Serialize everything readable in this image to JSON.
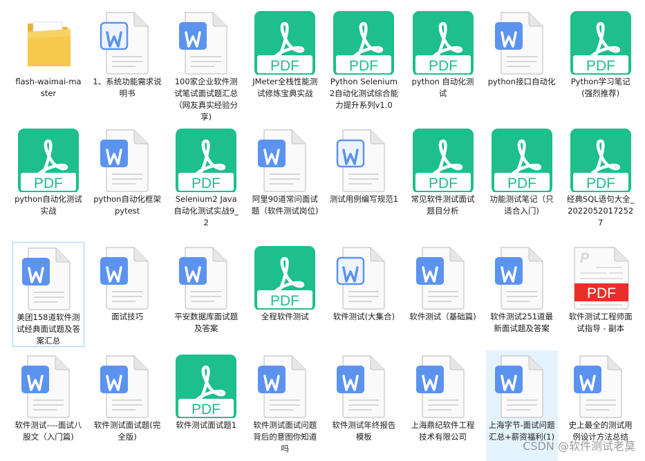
{
  "colors": {
    "pdf_green": "#1dbf8c",
    "word_blue": "#5b93ef",
    "pdf_red": "#e8302a",
    "folder": "#f6c94c",
    "selection_bg": "#e5f3ff",
    "focus_border": "#99d1ff"
  },
  "files": [
    {
      "name": "flash-waimai-master",
      "icon": "folder-icon"
    },
    {
      "name": "1、系统功能需求说明书",
      "icon": "word-outline-icon"
    },
    {
      "name": "100家企业软件测试笔试面试题汇总（网友真实经验分享)",
      "icon": "word-icon"
    },
    {
      "name": "JMeter全栈性能测试修炼宝典实战",
      "icon": "pdf-icon"
    },
    {
      "name": "Python Selenium2自动化测试综合能力提升系列v1.0",
      "icon": "pdf-icon"
    },
    {
      "name": "python 自动化测试",
      "icon": "pdf-icon"
    },
    {
      "name": "python接口自动化",
      "icon": "word-icon"
    },
    {
      "name": "Python学习笔记(强烈推荐)",
      "icon": "pdf-icon"
    },
    {
      "name": "python自动化测试实战",
      "icon": "pdf-icon"
    },
    {
      "name": "python自动化框架pytest",
      "icon": "word-icon"
    },
    {
      "name": "Selenium2 Java自动化测试实战9_2",
      "icon": "pdf-icon"
    },
    {
      "name": "阿里90道常问面试题（软件测试岗位)",
      "icon": "word-icon"
    },
    {
      "name": "测试用例编写规范1",
      "icon": "word-outline-icon"
    },
    {
      "name": "常见软件测试面试题目分析",
      "icon": "pdf-icon"
    },
    {
      "name": "功能测试笔记（只适合入门)",
      "icon": "pdf-icon"
    },
    {
      "name": "经典SQL语句大全_20220520172527",
      "icon": "pdf-icon"
    },
    {
      "name": "美团158道软件测试经典面试题及答案汇总",
      "icon": "word-icon",
      "state": "focus"
    },
    {
      "name": "面试技巧",
      "icon": "word-icon"
    },
    {
      "name": "平安数据库面试题及答案",
      "icon": "word-icon"
    },
    {
      "name": "全程软件测试",
      "icon": "pdf-icon"
    },
    {
      "name": "软件测试(大集合)",
      "icon": "word-outline-icon"
    },
    {
      "name": "软件测试（基础篇)",
      "icon": "word-icon"
    },
    {
      "name": "软件测试251道最新面试题及答案",
      "icon": "word-icon"
    },
    {
      "name": "软件测试工程师面试指导 - 副本",
      "icon": "pdf-red-icon"
    },
    {
      "name": "软件测试----面试八股文（入门篇)",
      "icon": "word-icon"
    },
    {
      "name": "软件测试面试题(完全版)",
      "icon": "word-icon"
    },
    {
      "name": "软件测试面试题1",
      "icon": "pdf-icon"
    },
    {
      "name": "软件测试面试问题背后的意图你知道吗",
      "icon": "word-icon"
    },
    {
      "name": "软件测试年终报告模板",
      "icon": "word-icon"
    },
    {
      "name": "上海鼎纪软件工程技术有限公司",
      "icon": "word-icon"
    },
    {
      "name": "上海字节-面试问题汇总+薪资福利(1)",
      "icon": "word-icon",
      "state": "selected"
    },
    {
      "name": "史上最全的测试用例设计方法总结",
      "icon": "word-icon"
    }
  ],
  "watermark": "CSDN @软件测试老莫"
}
